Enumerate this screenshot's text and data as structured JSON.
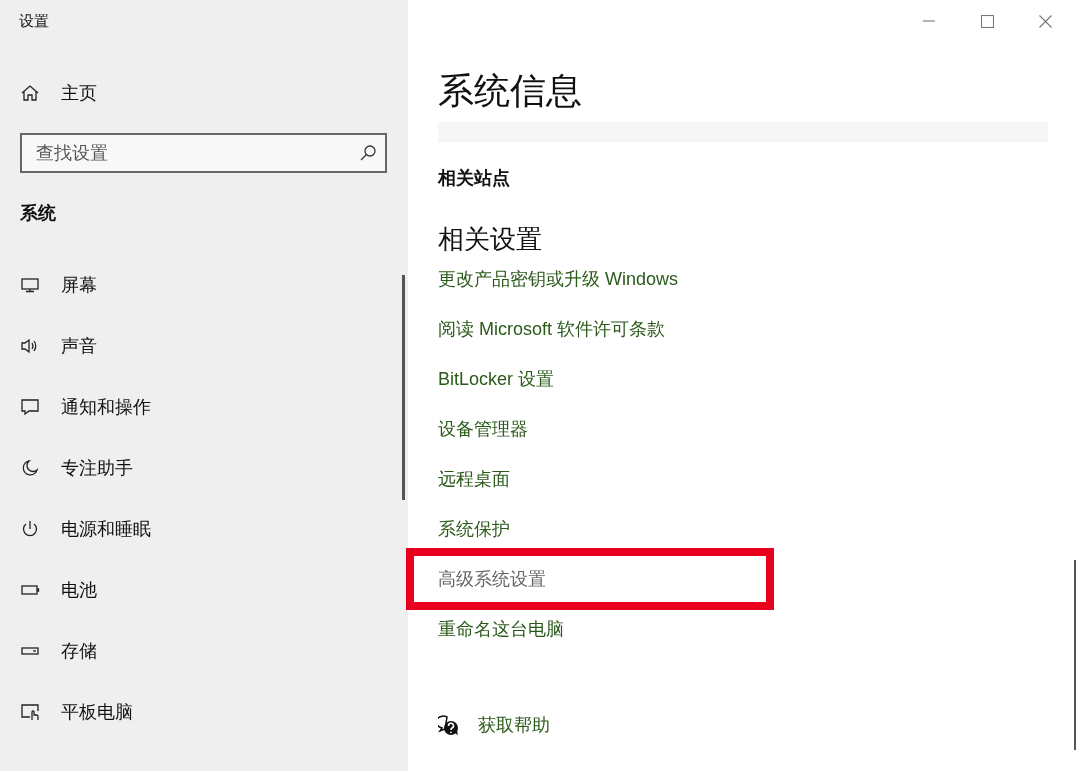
{
  "window": {
    "title": "设置"
  },
  "sidebar": {
    "home": "主页",
    "search": {
      "placeholder": "查找设置"
    },
    "section": "系统",
    "items": [
      {
        "label": "屏幕",
        "kind": "monitor"
      },
      {
        "label": "声音",
        "kind": "speaker"
      },
      {
        "label": "通知和操作",
        "kind": "message"
      },
      {
        "label": "专注助手",
        "kind": "moon"
      },
      {
        "label": "电源和睡眠",
        "kind": "power"
      },
      {
        "label": "电池",
        "kind": "battery"
      },
      {
        "label": "存储",
        "kind": "drive"
      },
      {
        "label": "平板电脑",
        "kind": "tablet"
      }
    ]
  },
  "main": {
    "title": "系统信息",
    "related_sites": "相关站点",
    "related_settings": "相关设置",
    "links": [
      {
        "label": "更改产品密钥或升级 Windows",
        "highlighted": false
      },
      {
        "label": "阅读 Microsoft 软件许可条款",
        "highlighted": false
      },
      {
        "label": "BitLocker 设置",
        "highlighted": false
      },
      {
        "label": "设备管理器",
        "highlighted": false
      },
      {
        "label": "远程桌面",
        "highlighted": false
      },
      {
        "label": "系统保护",
        "highlighted": false
      },
      {
        "label": "高级系统设置",
        "highlighted": true
      },
      {
        "label": "重命名这台电脑",
        "highlighted": false
      }
    ],
    "help": "获取帮助"
  }
}
